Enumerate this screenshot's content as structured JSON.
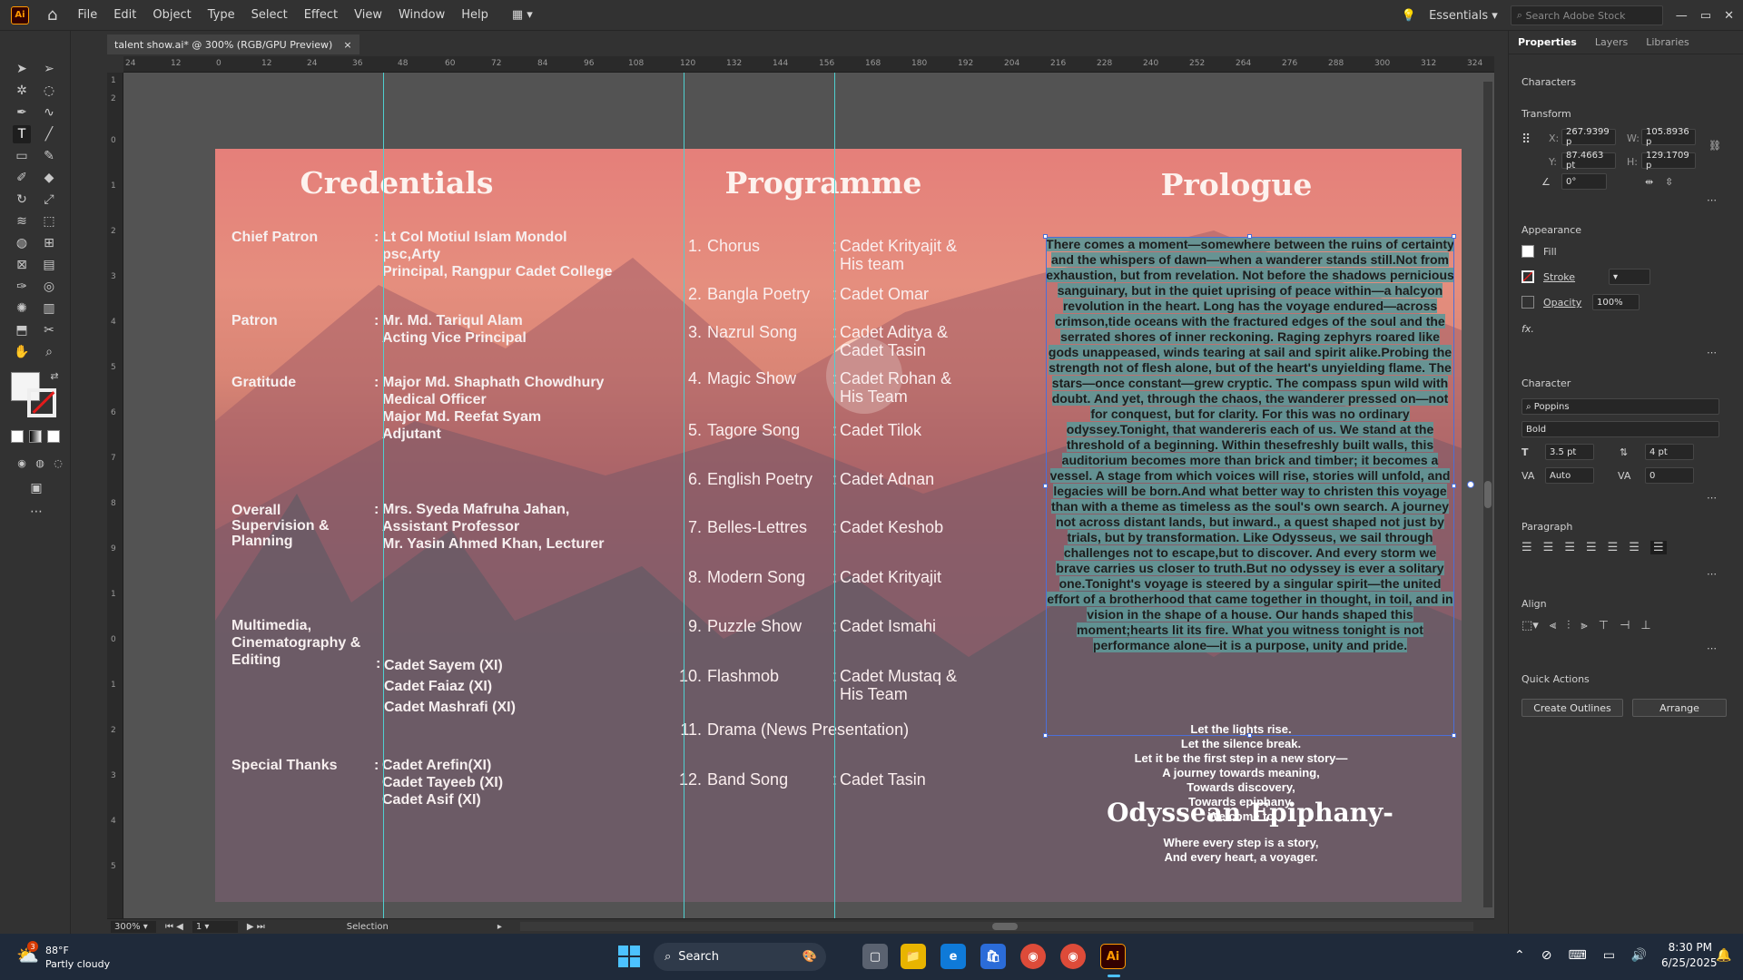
{
  "menubar": {
    "logo": "Ai",
    "items": [
      "File",
      "Edit",
      "Object",
      "Type",
      "Select",
      "Effect",
      "View",
      "Window",
      "Help"
    ],
    "workspace": "Essentials",
    "search_placeholder": "Search Adobe Stock"
  },
  "document_tab": {
    "title": "talent show.ai* @ 300% (RGB/GPU Preview)",
    "close": "×"
  },
  "ruler_h": [
    "24",
    "12",
    "0",
    "12",
    "24",
    "36",
    "48",
    "60",
    "72",
    "84",
    "96",
    "108",
    "120",
    "132",
    "144",
    "156",
    "168",
    "180",
    "192",
    "204",
    "216",
    "228",
    "240",
    "252",
    "264",
    "276",
    "288",
    "300",
    "312",
    "324"
  ],
  "ruler_v": [
    "1",
    "2",
    "0",
    "1",
    "2",
    "3",
    "4",
    "5",
    "6",
    "7",
    "8",
    "9",
    "1",
    "0",
    "1",
    "2",
    "3",
    "4",
    "5",
    "6",
    "7",
    "8",
    "9"
  ],
  "status": {
    "zoom": "300%",
    "page": "1",
    "mode": "Selection"
  },
  "artboard": {
    "credentials": {
      "title": "Credentials",
      "rows": [
        {
          "label": "Chief Patron",
          "value": "Lt Col Motiul  Islam Mondol\npsc,Arty\nPrincipal, Rangpur Cadet College"
        },
        {
          "label": "Patron",
          "value": "Mr. Md. Tariqul Alam\nActing Vice Principal"
        },
        {
          "label": "Gratitude",
          "value": "Major Md. Shaphath Chowdhury\nMedical Officer\nMajor  Md. Reefat Syam\nAdjutant"
        },
        {
          "label": "Overall\nSupervision &\nPlanning",
          "value": "Mrs. Syeda Mafruha Jahan,\nAssistant Professor\nMr. Yasin Ahmed Khan, Lecturer"
        },
        {
          "label": "Multimedia,\nCinematography &\nEditing",
          "value": "Cadet Sayem (XI)\nCadet Faiaz (XI)\nCadet Mashrafi (XI)"
        },
        {
          "label": "Special  Thanks",
          "value": "Cadet Arefin(XI)\nCadet  Tayeeb (XI)\nCadet Asif (XI)"
        }
      ]
    },
    "programme": {
      "title": "Programme",
      "items": [
        {
          "no": "1.",
          "name": "Chorus",
          "performer": "Cadet Krityajit &\n  His team"
        },
        {
          "no": "2.",
          "name": "Bangla Poetry",
          "performer": " Cadet Omar"
        },
        {
          "no": "3.",
          "name": "Nazrul Song",
          "performer": "Cadet Aditya &\nCadet Tasin"
        },
        {
          "no": "4.",
          "name": "Magic Show",
          "performer": "Cadet Rohan &\n His Team"
        },
        {
          "no": "5.",
          "name": "Tagore Song",
          "performer": "Cadet Tilok"
        },
        {
          "no": "6.",
          "name": "English Poetry",
          "performer": "Cadet Adnan"
        },
        {
          "no": "7.",
          "name": "Belles-Lettres",
          "performer": "Cadet Keshob"
        },
        {
          "no": "8.",
          "name": "Modern Song",
          "performer": "Cadet Krityajit"
        },
        {
          "no": "9.",
          "name": "Puzzle Show",
          "performer": " Cadet Ismahi"
        },
        {
          "no": "10.",
          "name": "Flashmob",
          "performer": "Cadet Mustaq &\nHis Team"
        },
        {
          "no": "11.",
          "name": "Drama (News Presentation)",
          "performer": ""
        },
        {
          "no": "12.",
          "name": " Band Song",
          "performer": "Cadet Tasin"
        }
      ]
    },
    "prologue": {
      "title": "Prologue",
      "body": "There comes a moment—somewhere between the ruins of certainty and the whispers of dawn—when a wanderer stands still.Not from exhaustion, but from revelation. Not before the shadows pernicious sanguinary, but in the quiet uprising of peace within—a halcyon revolution in the heart. Long has the voyage endured—across crimson,tide oceans with the fractured edges of the soul and the serrated shores of inner reckoning. Raging zephyrs roared like gods unappeased, winds tearing at sail and spirit alike.Probing the strength not of flesh alone, but of the heart's unyielding flame. The stars—once constant—grew cryptic.  The compass spun wild with doubt. And yet, through the chaos, the wanderer pressed on—not for conquest, but for clarity. For this was no ordinary odyssey.Tonight, that wandereris each of us. We stand at the threshold of a beginning. Within thesefreshly built walls, this auditorium becomes more than brick and timber; it becomes a vessel. A stage from which voices will rise, stories will unfold, and legacies will be born.And what better way to christen this voyage than with a theme as timeless as the soul's own search. A journey not across distant lands, but inward., a quest shaped not just by trials, but by transformation. Like Odysseus, we sail through challenges not to escape,but to discover. And every storm we brave carries us closer to truth.But no odyssey is ever a solitary one.Tonight's voyage is steered by a singular spirit—the united effort of a brotherhood that came together in thought, in toil, and in vision in the shape of a house. Our hands shaped this moment;hearts lit its fire. What you witness tonight is not performance alone—it is a purpose, unity and pride.",
      "closing": [
        "Let the lights rise.",
        "Let the silence break.",
        "Let it be the first step in a new story—",
        "A journey towards meaning,",
        "Towards discovery,",
        "Towards epiphany.",
        "Welcome to"
      ],
      "event_name": "Odyssean Epiphany-",
      "tagline": [
        "Where every step is a story,",
        "And every heart, a voyager."
      ]
    }
  },
  "panel": {
    "tabs": [
      "Properties",
      "Layers",
      "Libraries"
    ],
    "characters_label": "Characters",
    "transform": {
      "label": "Transform",
      "x_label": "X:",
      "x": "267.9399 p",
      "y_label": "Y:",
      "y": "87.4663 pt",
      "w_label": "W:",
      "w": "105.8936 p",
      "h_label": "H:",
      "h": "129.1709 p",
      "angle": "0°"
    },
    "appearance": {
      "label": "Appearance",
      "fill": "Fill",
      "stroke": "Stroke",
      "opacity": "Opacity",
      "opacity_value": "100%",
      "fx": "fx."
    },
    "character": {
      "label": "Character",
      "font": "Poppins",
      "style": "Bold",
      "size": "3.5 pt",
      "leading": "4 pt",
      "kerning": "Auto",
      "tracking": "0"
    },
    "paragraph_label": "Paragraph",
    "align_label": "Align",
    "quick_actions": {
      "label": "Quick Actions",
      "create_outlines": "Create Outlines",
      "arrange": "Arrange"
    }
  },
  "taskbar": {
    "weather_temp": "88°F",
    "weather_desc": "Partly cloudy",
    "weather_badge": "3",
    "search": "Search",
    "time": "8:30 PM",
    "date": "6/25/2025"
  }
}
